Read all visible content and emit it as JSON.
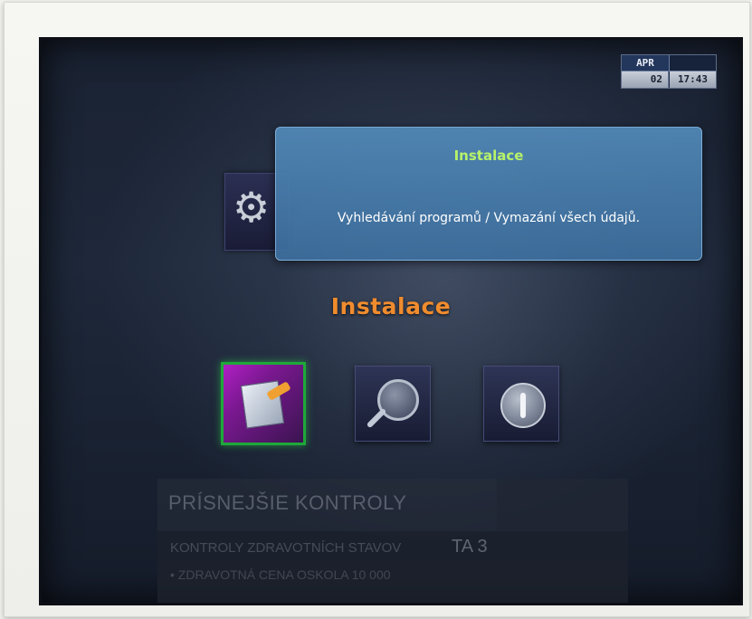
{
  "datetime": {
    "month": "APR",
    "day": "02",
    "time": "17:43"
  },
  "tooltip": {
    "title": "Instalace",
    "description": "Vyhledávání programů / Vymazání všech údajů."
  },
  "section": {
    "title": "Instalace"
  },
  "menu": {
    "items": [
      {
        "name": "installation-wizard",
        "icon": "document-edit-icon",
        "selected": true
      },
      {
        "name": "channel-search",
        "icon": "magnifier-icon",
        "selected": false
      },
      {
        "name": "information",
        "icon": "info-icon",
        "selected": false
      }
    ]
  },
  "background_broadcast": {
    "headline": "PRÍSNEJŠIE KONTROLY",
    "ticker_line": "KONTROLY ZDRAVOTNÍCH STAVOV",
    "channel_tag": "TA 3",
    "ticker_line2": "• ZDRAVOTNÁ CENA OSKOLA 10 000"
  },
  "colors": {
    "selection_border": "#1fa83a",
    "section_title": "#f08c2e",
    "tooltip_title": "#b8f26a",
    "tooltip_bg": "#528ab9"
  }
}
